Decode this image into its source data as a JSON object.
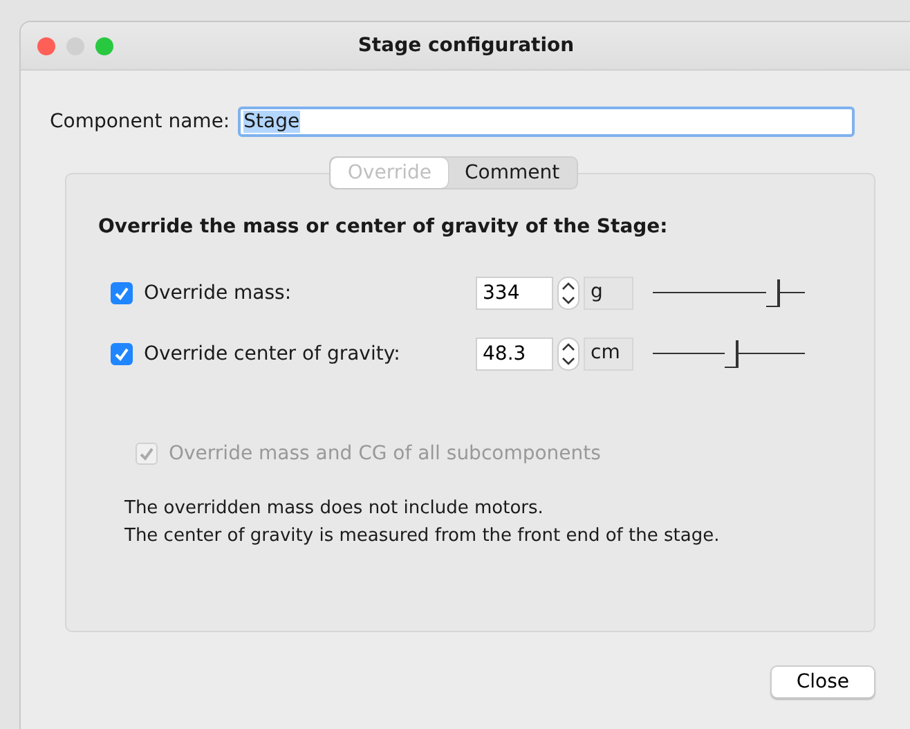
{
  "window": {
    "title": "Stage configuration"
  },
  "component_name": {
    "label": "Component name:",
    "value": "Stage"
  },
  "tabs": [
    {
      "label": "Override",
      "selected": true
    },
    {
      "label": "Comment",
      "selected": false
    }
  ],
  "heading": "Override the mass or center of gravity of the Stage:",
  "overrides": [
    {
      "label": "Override mass:",
      "checked": true,
      "value": "334",
      "unit": "g",
      "level": 0.79
    },
    {
      "label": "Override center of gravity:",
      "checked": true,
      "value": "48.3",
      "unit": "cm",
      "level": 0.52
    }
  ],
  "subcomponents": {
    "label": "Override mass and CG of all subcomponents",
    "checked": true,
    "disabled": true
  },
  "notes": [
    "The overridden mass does not include motors.",
    "The center of gravity is measured from the front end of the stage."
  ],
  "buttons": [
    "Close"
  ]
}
